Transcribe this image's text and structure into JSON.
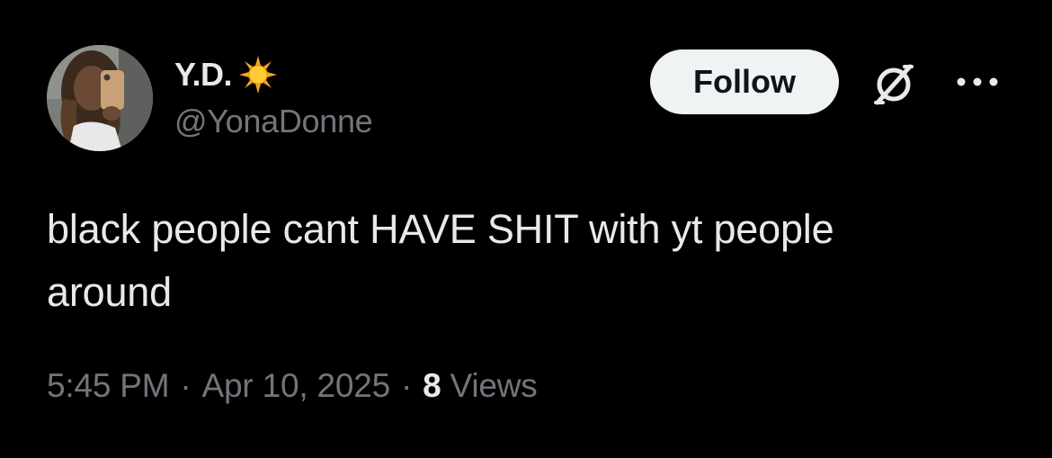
{
  "author": {
    "display_name": "Y.D.",
    "badge_icon": "sun-emoji-icon",
    "handle": "@YonaDonne",
    "avatar_icon": "profile-photo"
  },
  "actions": {
    "follow_label": "Follow",
    "grok_icon": "grok-icon",
    "more_icon": "more-options-icon"
  },
  "tweet": {
    "text": "black people cant HAVE SHIT with yt people\naround"
  },
  "meta": {
    "time": "5:45 PM",
    "separator": "·",
    "date": "Apr 10, 2025",
    "views_count": "8",
    "views_label": "Views"
  },
  "colors": {
    "background": "#000000",
    "primary_text": "#e7e9ea",
    "secondary_text": "#71767b",
    "follow_button_bg": "#eff3f4",
    "follow_button_text": "#0f1419"
  }
}
